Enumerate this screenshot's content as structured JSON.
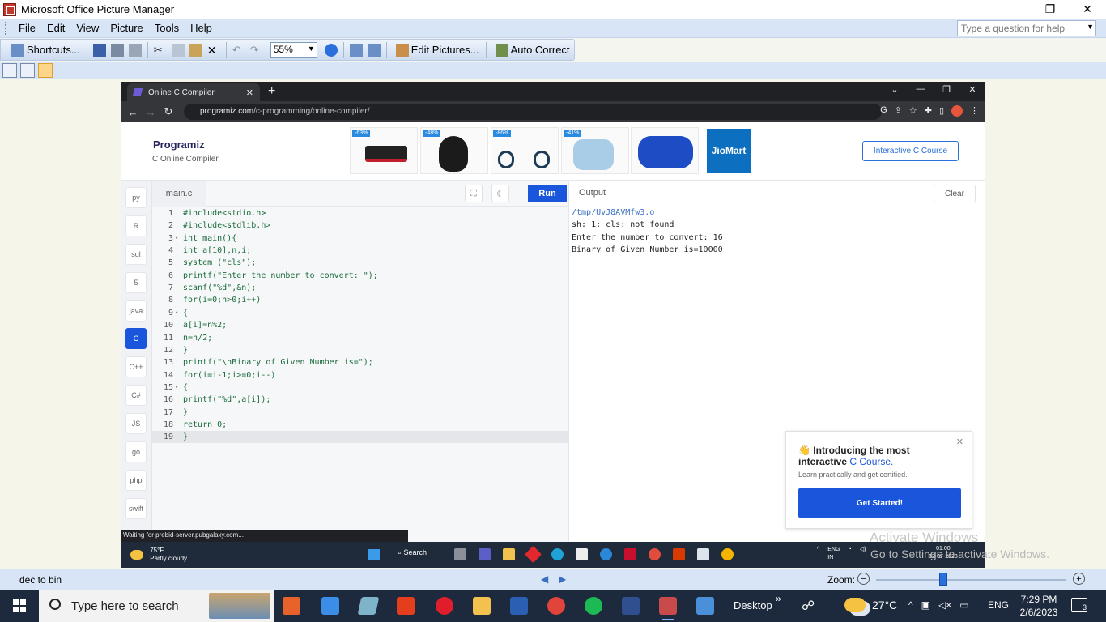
{
  "window": {
    "title": "Microsoft Office Picture Manager",
    "controls": [
      "—",
      "❐",
      "✕"
    ]
  },
  "menu": {
    "items": [
      "File",
      "Edit",
      "View",
      "Picture",
      "Tools",
      "Help"
    ],
    "help_placeholder": "Type a question for help"
  },
  "toolbar": {
    "shortcuts": "Shortcuts...",
    "zoom": "55%",
    "edit_pictures": "Edit Pictures...",
    "auto_correct": "Auto Correct"
  },
  "browser": {
    "tab_title": "Online C Compiler",
    "url_host": "programiz.com",
    "url_path": "/c-programming/online-compiler/"
  },
  "programiz": {
    "logo": "Programiz",
    "subtitle": "C Online Compiler",
    "ad_badges": [
      "-63%",
      "-48%",
      "-86%",
      "-41%"
    ],
    "jiomart": "JioMart",
    "course_button": "Interactive C Course",
    "file_tab": "main.c",
    "run_label": "Run",
    "output_label": "Output",
    "clear_label": "Clear",
    "languages": [
      "py",
      "R",
      "sql",
      "5",
      "java",
      "C",
      "C++",
      "C#",
      "JS",
      "go",
      "php",
      "swift"
    ],
    "code_lines": [
      "#include<stdio.h>",
      "#include<stdlib.h>",
      "int main(){",
      "int a[10],n,i;",
      "system (\"cls\");",
      "printf(\"Enter the number to convert: \");",
      "scanf(\"%d\",&n);",
      "for(i=0;n>0;i++)",
      "{",
      "a[i]=n%2;",
      "n=n/2;",
      "}",
      "printf(\"\\nBinary of Given Number is=\");",
      "for(i=i-1;i>=0;i--)",
      "{",
      "printf(\"%d\",a[i]);",
      "}",
      "return 0;",
      "}"
    ],
    "output_lines": [
      "/tmp/UvJ8AVMfw3.o",
      "sh: 1: cls: not found",
      "Enter the number to convert: 16",
      "Binary of Given Number is=10000"
    ],
    "promo_title_a": "👋 Introducing the most interactive ",
    "promo_title_b": "C Course.",
    "promo_sub": "Learn practically and get certified.",
    "promo_button": "Get Started!",
    "status_popup": "Waiting for prebid-server.pubgalaxy.com..."
  },
  "inner_taskbar": {
    "temp": "75°F",
    "weather": "Partly cloudy",
    "search": "Search",
    "lang": "ENG",
    "region": "IN",
    "time": "01:00",
    "date": "12-07-2023"
  },
  "watermark": {
    "line1": "Activate Windows",
    "line2": "Go to Settings to activate Windows."
  },
  "statusbar": {
    "filename": "dec to bin",
    "zoom_label": "Zoom:"
  },
  "taskbar": {
    "search_placeholder": "Type here to search",
    "desktop": "Desktop",
    "temperature": "27°C",
    "lang": "ENG",
    "time": "7:29 PM",
    "date": "2/6/2023",
    "notifications": "3"
  },
  "colors": {
    "accent": "#1a56db",
    "office_bar": "#d8e5f6",
    "taskbar": "#1d2a3d"
  }
}
